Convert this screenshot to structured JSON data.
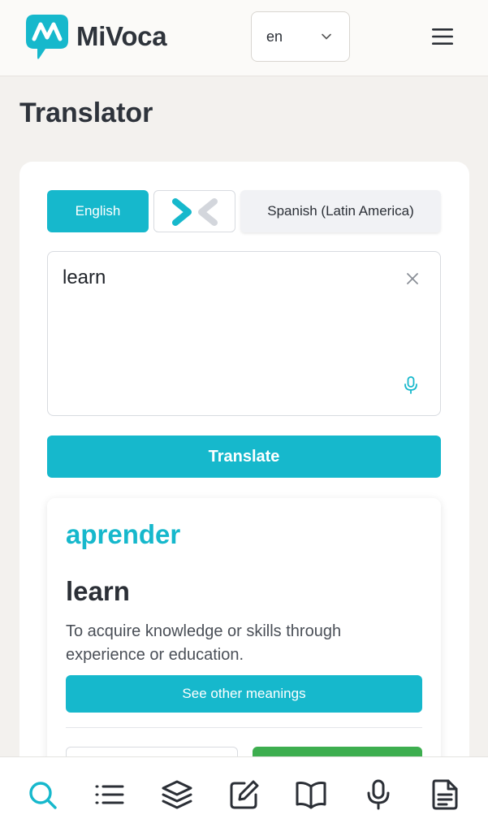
{
  "brand": {
    "name": "MiVoca",
    "accent": "#16b8cc"
  },
  "header": {
    "language_value": "en",
    "menu_icon": "hamburger-menu-icon"
  },
  "page": {
    "title": "Translator"
  },
  "translator": {
    "source_language": "English",
    "target_language": "Spanish (Latin America)",
    "input_value": "learn",
    "translate_label": "Translate"
  },
  "result": {
    "translation": "aprender",
    "word": "learn",
    "definition": "To acquire knowledge or skills through experience or education.",
    "other_meanings_label": "See other meanings"
  },
  "bottom_nav": {
    "items": [
      {
        "name": "search-icon",
        "active": true
      },
      {
        "name": "list-icon",
        "active": false
      },
      {
        "name": "layers-icon",
        "active": false
      },
      {
        "name": "edit-icon",
        "active": false
      },
      {
        "name": "book-icon",
        "active": false
      },
      {
        "name": "microphone-icon",
        "active": false
      },
      {
        "name": "document-icon",
        "active": false
      }
    ]
  }
}
